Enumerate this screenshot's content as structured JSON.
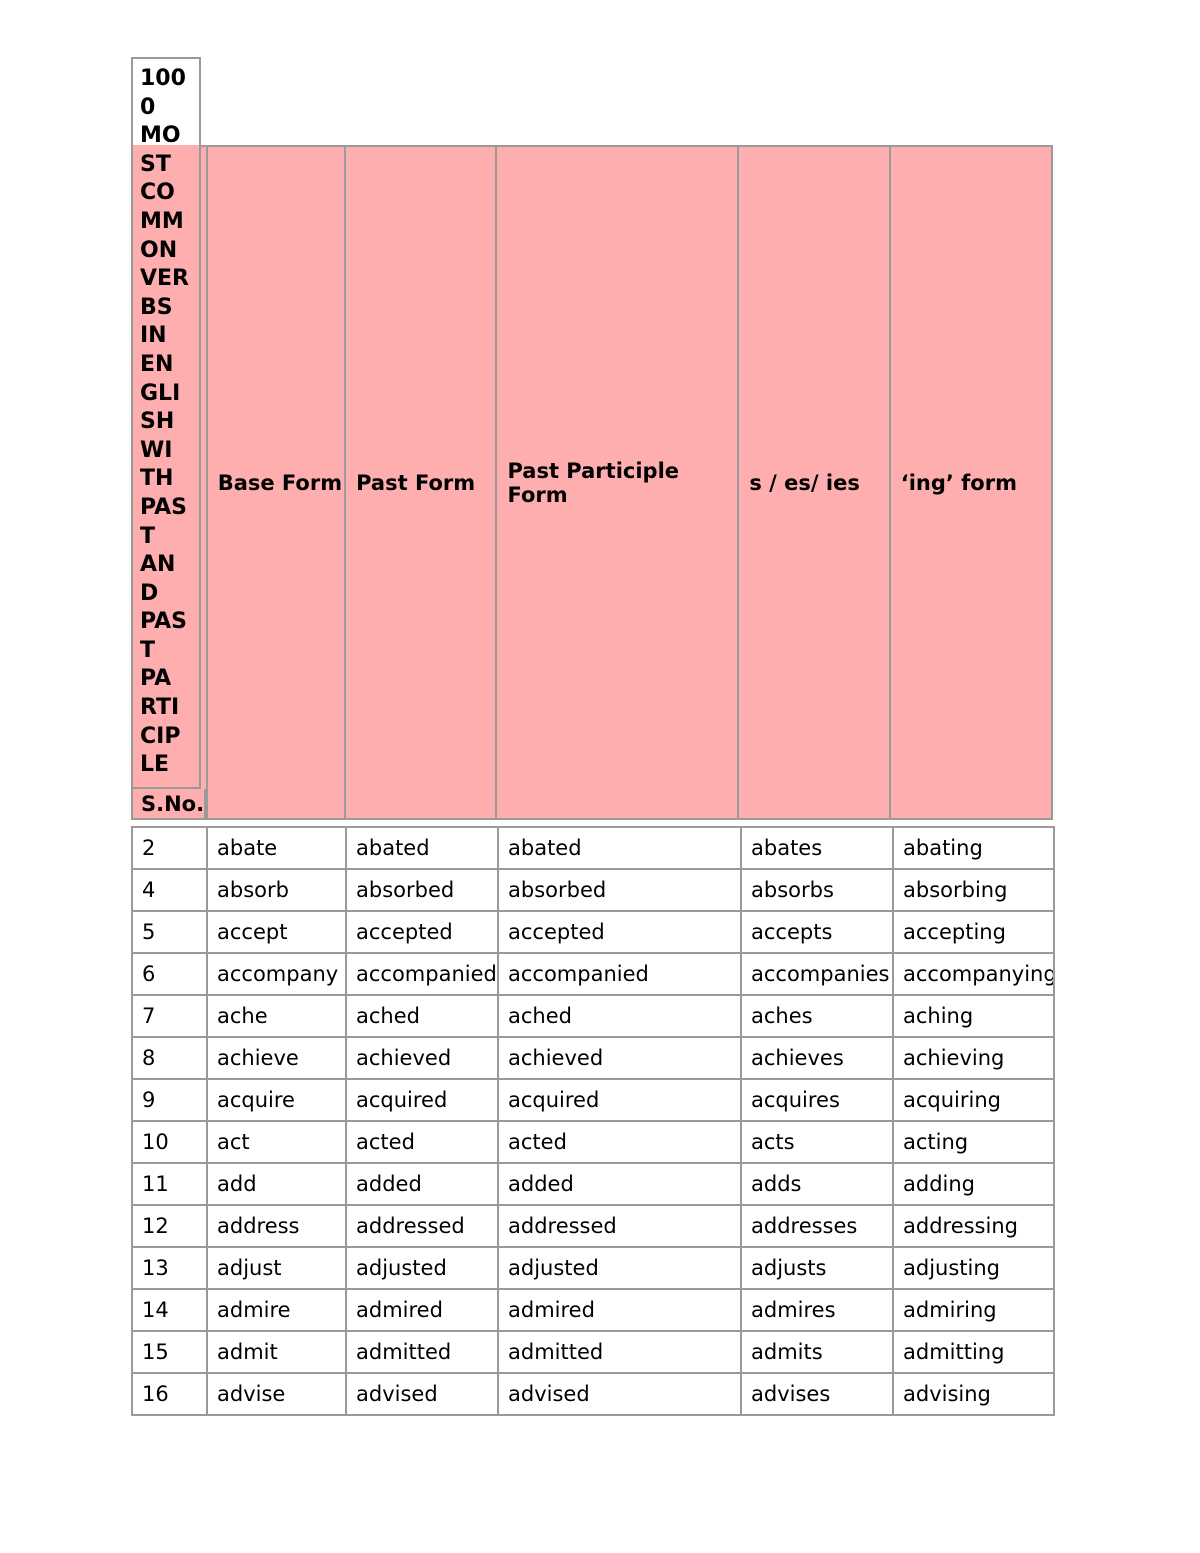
{
  "document": {
    "title_vertical": "1000 MOST COMMON VERBS IN ENGLISH WITH PAST AND PAST PARTICIPLE",
    "title_lines": [
      "100",
      "0",
      "MO",
      "ST",
      "CO",
      "MM",
      "ON",
      "VER",
      "BS",
      "IN",
      "EN",
      "GLI",
      "SH",
      "WI",
      "TH",
      "PAS",
      "T",
      "AN",
      "D",
      "PAS",
      "T",
      "PA",
      "RTI",
      "CIP",
      "LE"
    ],
    "background_color": "#ffffff"
  },
  "table": {
    "header_background": "#ffaeb0",
    "border_color": "#9a9a9a",
    "serial_header": "S.No.",
    "columns": [
      {
        "key": "sno",
        "label": "S.No."
      },
      {
        "key": "base",
        "label": "Base Form"
      },
      {
        "key": "past",
        "label": "Past Form"
      },
      {
        "key": "pp",
        "label": "Past Participle Form"
      },
      {
        "key": "s",
        "label": "s / es/ ies"
      },
      {
        "key": "ing",
        "label": "‘ing’ form"
      }
    ],
    "rows": [
      {
        "sno": "2",
        "base": "abate",
        "past": "abated",
        "pp": "abated",
        "s": "abates",
        "ing": "abating"
      },
      {
        "sno": "4",
        "base": "absorb",
        "past": "absorbed",
        "pp": "absorbed",
        "s": "absorbs",
        "ing": "absorbing"
      },
      {
        "sno": "5",
        "base": "accept",
        "past": "accepted",
        "pp": "accepted",
        "s": "accepts",
        "ing": "accepting"
      },
      {
        "sno": "6",
        "base": "accompany",
        "past": "accompanied",
        "pp": "accompanied",
        "s": "accompanies",
        "ing": "accompanying"
      },
      {
        "sno": "7",
        "base": "ache",
        "past": "ached",
        "pp": "ached",
        "s": "aches",
        "ing": "aching"
      },
      {
        "sno": "8",
        "base": "achieve",
        "past": "achieved",
        "pp": "achieved",
        "s": "achieves",
        "ing": "achieving"
      },
      {
        "sno": "9",
        "base": "acquire",
        "past": "acquired",
        "pp": "acquired",
        "s": "acquires",
        "ing": "acquiring"
      },
      {
        "sno": "10",
        "base": "act",
        "past": "acted",
        "pp": "acted",
        "s": "acts",
        "ing": "acting"
      },
      {
        "sno": "11",
        "base": "add",
        "past": "added",
        "pp": "added",
        "s": "adds",
        "ing": "adding"
      },
      {
        "sno": "12",
        "base": "address",
        "past": "addressed",
        "pp": "addressed",
        "s": "addresses",
        "ing": "addressing"
      },
      {
        "sno": "13",
        "base": "adjust",
        "past": "adjusted",
        "pp": "adjusted",
        "s": "adjusts",
        "ing": "adjusting"
      },
      {
        "sno": "14",
        "base": "admire",
        "past": "admired",
        "pp": "admired",
        "s": "admires",
        "ing": "admiring"
      },
      {
        "sno": "15",
        "base": "admit",
        "past": "admitted",
        "pp": "admitted",
        "s": "admits",
        "ing": "admitting"
      },
      {
        "sno": "16",
        "base": "advise",
        "past": "advised",
        "pp": "advised",
        "s": "advises",
        "ing": "advising"
      }
    ]
  }
}
